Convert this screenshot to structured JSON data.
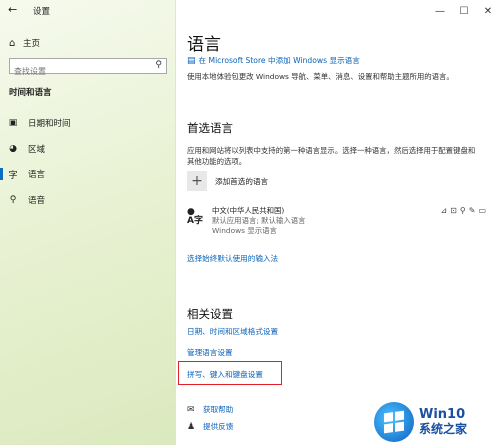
{
  "window": {
    "title": "设置",
    "controls": [
      "—",
      "☐",
      "✕"
    ]
  },
  "sidebar": {
    "home_label": "主页",
    "search_placeholder": "查找设置",
    "section": "时间和语言",
    "items": [
      {
        "label": "日期和时间",
        "icon": "calendar-clock-icon",
        "active": false
      },
      {
        "label": "区域",
        "icon": "globe-icon",
        "active": false
      },
      {
        "label": "语言",
        "icon": "language-icon",
        "active": true
      },
      {
        "label": "语音",
        "icon": "microphone-icon",
        "active": false
      }
    ]
  },
  "main": {
    "title": "语言",
    "store_link": "在 Microsoft Store 中添加 Windows 显示语言",
    "store_desc": "使用本地体验包更改 Windows 导航、菜单、消息、设置和帮助主题所用的语言。",
    "preferred_heading": "首选语言",
    "preferred_desc": "应用和网站将以列表中支持的第一种语言显示。选择一种语言，然后选择用于配置键盘和其他功能的选项。",
    "add_language": "添加首选的语言",
    "language_item": {
      "name": "中文(中华人民共和国)",
      "sub1": "默认应用语言; 默认输入语言",
      "sub2": "Windows 显示语言"
    },
    "input_method_link": "选择始终默认使用的输入法",
    "related_heading": "相关设置",
    "related_links": [
      "日期、时间和区域格式设置",
      "管理语言设置",
      "拼写、键入和键盘设置"
    ],
    "help_links": [
      "获取帮助",
      "提供反馈"
    ]
  },
  "watermark": {
    "line1": "Win10",
    "line2": "系统之家"
  },
  "colors": {
    "link": "#0a62b8",
    "accent": "#0a6dbf",
    "highlight": "#e2202a"
  }
}
